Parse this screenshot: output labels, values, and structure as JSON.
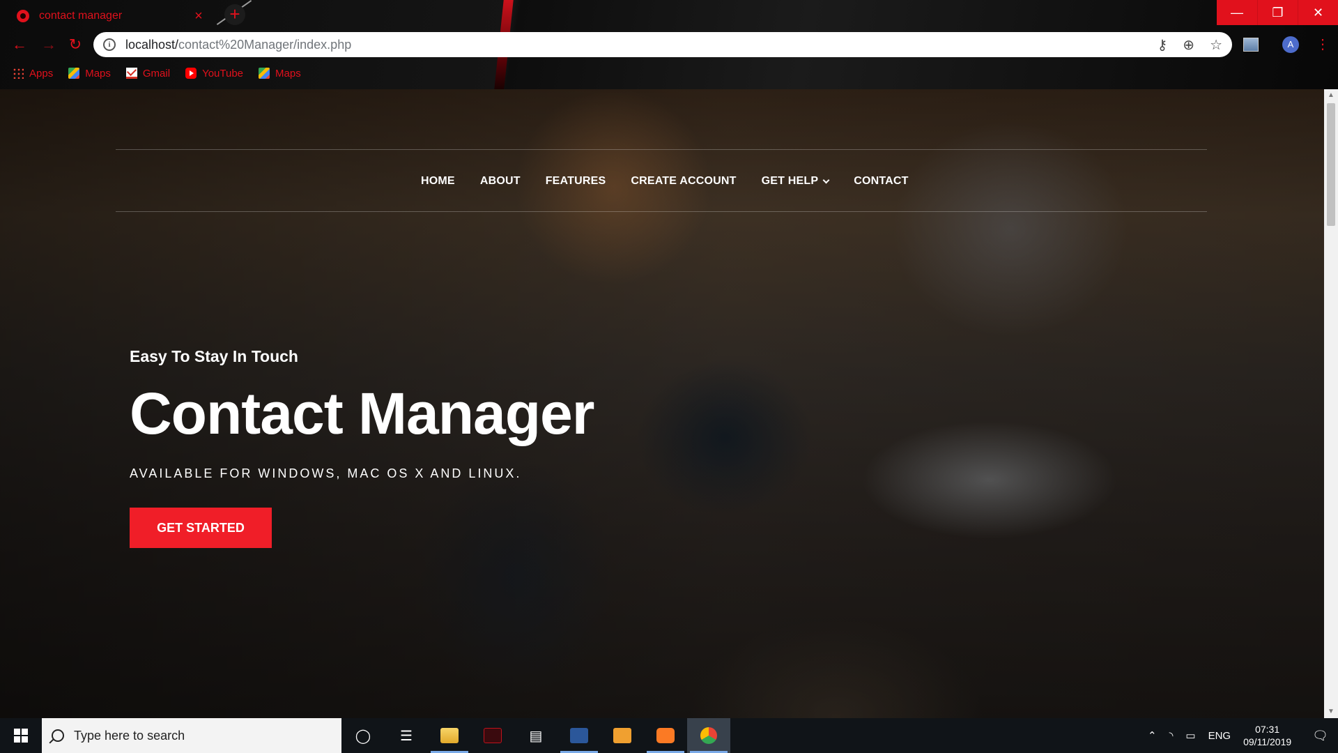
{
  "browser": {
    "tab_title": "contact manager",
    "tab_close": "×",
    "new_tab": "+",
    "url_host": "localhost/",
    "url_path": "contact%20Manager/index.php",
    "bookmarks": [
      {
        "label": "Apps",
        "icon": "apps-icon"
      },
      {
        "label": "Maps",
        "icon": "maps-icon"
      },
      {
        "label": "Gmail",
        "icon": "gmail-icon"
      },
      {
        "label": "YouTube",
        "icon": "youtube-icon"
      },
      {
        "label": "Maps",
        "icon": "maps-icon"
      }
    ],
    "avatar_letter": "A",
    "accent_color": "#e1111c"
  },
  "site": {
    "menu": {
      "home": "HOME",
      "about": "ABOUT",
      "features": "FEATURES",
      "create_account": "CREATE ACCOUNT",
      "get_help": "GET HELP",
      "contact": "CONTACT"
    },
    "hero": {
      "kicker": "Easy To Stay In Touch",
      "title": "Contact Manager",
      "subtitle": "AVAILABLE FOR WINDOWS, MAC OS X AND LINUX.",
      "cta_label": "GET STARTED",
      "cta_color": "#f01e28"
    }
  },
  "taskbar": {
    "search_placeholder": "Type here to search",
    "language": "ENG",
    "time": "07:31",
    "date": "09/11/2019"
  }
}
